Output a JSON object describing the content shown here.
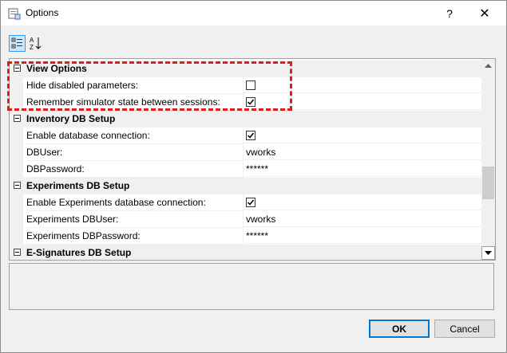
{
  "window": {
    "title": "Options",
    "help_glyph": "?",
    "close_glyph": "✕"
  },
  "toolbar": {
    "categorized_icon": "categorized-view-icon",
    "alphabetical_icon": "sort-alphabetical-icon"
  },
  "grid": {
    "categories": [
      {
        "label": "View Options",
        "items": [
          {
            "name": "Hide disabled parameters:",
            "type": "checkbox",
            "checked": false
          },
          {
            "name": "Remember simulator state between sessions:",
            "type": "checkbox",
            "checked": true
          }
        ]
      },
      {
        "label": "Inventory DB Setup",
        "items": [
          {
            "name": "Enable database connection:",
            "type": "checkbox",
            "checked": true
          },
          {
            "name": "DBUser:",
            "type": "text",
            "value": "vworks"
          },
          {
            "name": "DBPassword:",
            "type": "text",
            "value": "******"
          }
        ]
      },
      {
        "label": "Experiments DB Setup",
        "items": [
          {
            "name": "Enable Experiments database connection:",
            "type": "checkbox",
            "checked": true
          },
          {
            "name": "Experiments DBUser:",
            "type": "text",
            "value": "vworks"
          },
          {
            "name": "Experiments DBPassword:",
            "type": "text",
            "value": "******"
          }
        ]
      },
      {
        "label": "E-Signatures DB Setup",
        "items": []
      }
    ]
  },
  "buttons": {
    "ok": "OK",
    "cancel": "Cancel"
  },
  "colors": {
    "highlight": "#e31b1b",
    "focus": "#0078d7"
  }
}
